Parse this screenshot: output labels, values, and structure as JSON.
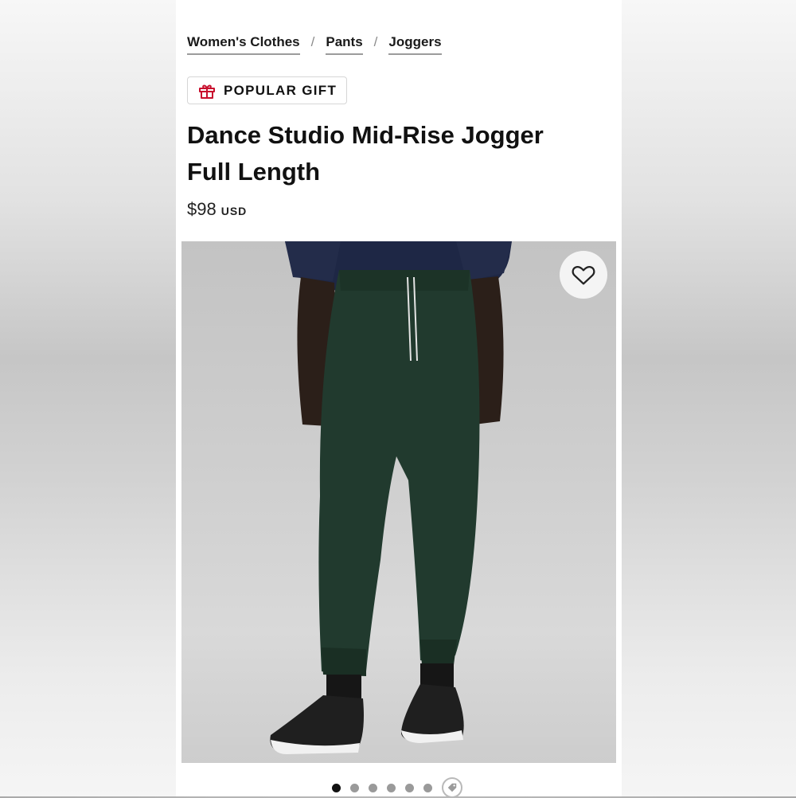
{
  "breadcrumb": {
    "items": [
      "Women's Clothes",
      "Pants",
      "Joggers"
    ],
    "separator": "/"
  },
  "badge": {
    "label": "POPULAR GIFT",
    "icon": "gift-icon",
    "icon_color": "#c8102e"
  },
  "product": {
    "title_line1": "Dance Studio Mid-Rise Jogger",
    "title_line2": "Full Length",
    "price": "$98",
    "currency": "USD",
    "pants_color": "#213a2e"
  },
  "wishlist": {
    "icon": "heart-icon"
  },
  "carousel": {
    "image_count": 6,
    "active_index": 0,
    "extra_icon": "tag-icon"
  }
}
